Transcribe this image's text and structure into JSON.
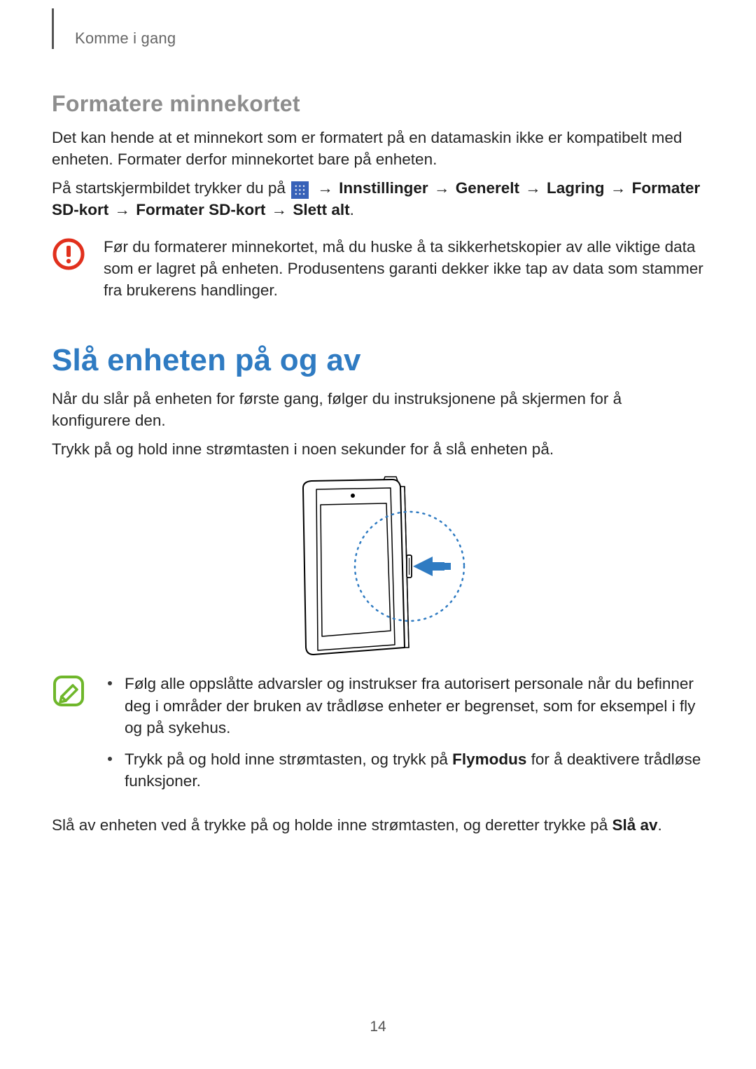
{
  "header": {
    "breadcrumb": "Komme i gang"
  },
  "section1": {
    "title": "Formatere minnekortet",
    "para1": "Det kan hende at et minnekort som er formatert på en datamaskin ikke er kompatibelt med enheten. Formater derfor minnekortet bare på enheten.",
    "path_prefix": "På startskjermbildet trykker du på ",
    "arrow": "→",
    "step1": "Innstillinger",
    "step2": "Generelt",
    "step3": "Lagring",
    "step4": "Formater SD-kort",
    "step5": "Formater SD-kort",
    "step6": "Slett alt",
    "period": ".",
    "warning": "Før du formaterer minnekortet, må du huske å ta sikkerhetskopier av alle viktige data som er lagret på enheten. Produsentens garanti dekker ikke tap av data som stammer fra brukerens handlinger."
  },
  "section2": {
    "title": "Slå enheten på og av",
    "para1": "Når du slår på enheten for første gang, følger du instruksjonene på skjermen for å konfigurere den.",
    "para2": "Trykk på og hold inne strømtasten i noen sekunder for å slå enheten på.",
    "note_bullet1": "Følg alle oppslåtte advarsler og instrukser fra autorisert personale når du befinner deg i områder der bruken av trådløse enheter er begrenset, som for eksempel i fly og på sykehus.",
    "note_bullet2_pre": "Trykk på og hold inne strømtasten, og trykk på ",
    "note_bullet2_bold": "Flymodus",
    "note_bullet2_post": " for å deaktivere trådløse funksjoner.",
    "para3_pre": "Slå av enheten ved å trykke på og holde inne strømtasten, og deretter trykke på ",
    "para3_bold": "Slå av",
    "para3_post": "."
  },
  "page_number": "14"
}
